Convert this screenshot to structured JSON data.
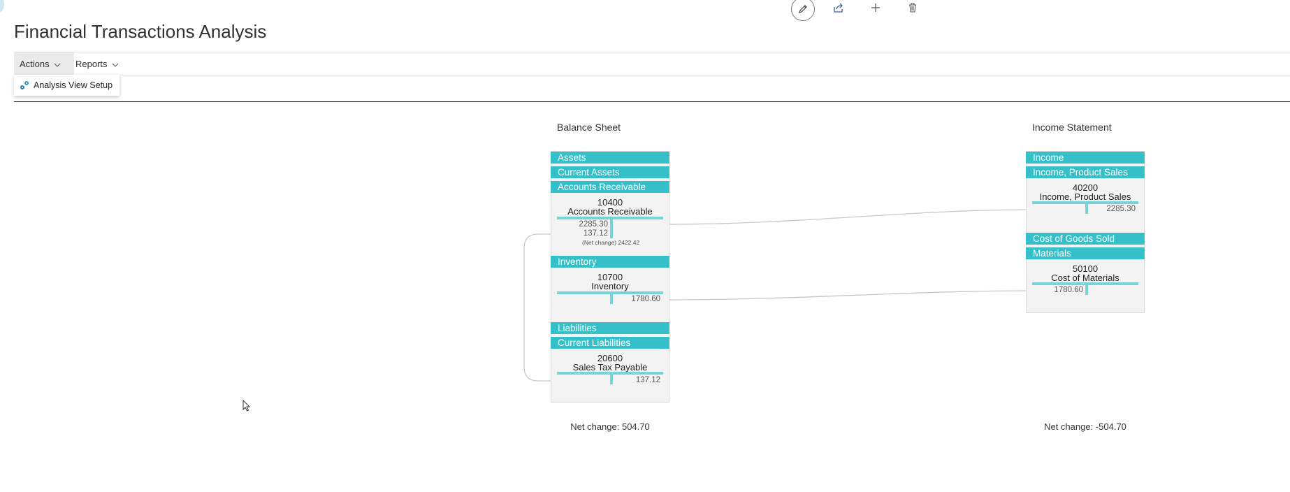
{
  "page": {
    "title": "Financial Transactions Analysis"
  },
  "top_toolbar": {
    "edit_icon": "pencil-icon",
    "share_icon": "share-icon",
    "add_icon": "plus-icon",
    "delete_icon": "trash-icon"
  },
  "action_bar": {
    "tabs": [
      {
        "label": "Actions",
        "active": true
      },
      {
        "label": "Reports",
        "active": false
      }
    ],
    "dropdown_items": [
      {
        "label": "Analysis View Setup",
        "icon": "setup-gear-icon"
      }
    ]
  },
  "balance_sheet": {
    "heading": "Balance Sheet",
    "bands": {
      "assets": "Assets",
      "current_assets": "Current Assets",
      "accounts_receivable": "Accounts Receivable",
      "inventory": "Inventory",
      "liabilities": "Liabilities",
      "current_liabilities": "Current Liabilities"
    },
    "accounts": {
      "ar": {
        "number": "10400",
        "name": "Accounts Receivable",
        "debit": "2285.30",
        "credit": "137.12",
        "net_change": "(Net change) 2422.42"
      },
      "inv": {
        "number": "10700",
        "name": "Inventory",
        "value": "1780.60"
      },
      "stp": {
        "number": "20600",
        "name": "Sales Tax Payable",
        "value": "137.12"
      }
    },
    "net_change": "Net change: 504.70"
  },
  "income_statement": {
    "heading": "Income Statement",
    "bands": {
      "income": "Income",
      "income_product_sales": "Income, Product Sales",
      "cost_of_goods_sold": "Cost of Goods Sold",
      "materials": "Materials"
    },
    "accounts": {
      "ips": {
        "number": "40200",
        "name": "Income, Product Sales",
        "value": "2285.30"
      },
      "com": {
        "number": "50100",
        "name": "Cost of Materials",
        "value": "1780.60"
      }
    },
    "net_change": "Net change: -504.70"
  },
  "colors": {
    "band": "#35bfc8",
    "bar": "#78d3d9",
    "panel": "#f3f3f3",
    "connector": "#c8c8c8"
  }
}
